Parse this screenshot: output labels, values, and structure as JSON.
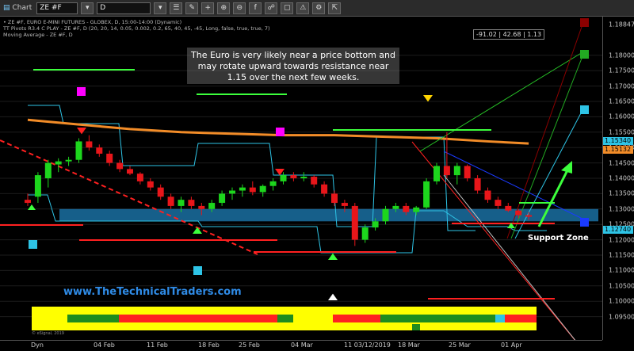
{
  "toolbar": {
    "window_title": "Chart",
    "symbol": "ZE #F",
    "interval": "D"
  },
  "legend": {
    "line1": "• ZE #F, EURO E-MINI FUTURES - GLOBEX, D, 15:00-14:00 (Dynamic)",
    "line2": "TT Pivots R3.4 C PLAY - ZE #F, D (20, 20, 14, 0.05, 0.002, 0.2, 65, 40, 45, -45, Long, false, true, true, 7)",
    "line3": "Moving Average - ZE #F, D"
  },
  "annotation": {
    "note": "The Euro is very likely near a price bottom and may rotate upward towards resistance near 1.15 over the next few weeks.",
    "support_zone": "Support Zone",
    "website": "www.TheTechnicalTraders.com",
    "copyright": "© eSignal, 2019",
    "readout": "-91.02 | 42.68 | 1.13"
  },
  "price_axis": {
    "labels": [
      "1.18847",
      "1.18000",
      "1.17500",
      "1.17000",
      "1.16500",
      "1.16000",
      "1.15500",
      "1.15000",
      "1.14500",
      "1.14000",
      "1.13500",
      "1.13000",
      "1.12500",
      "1.12000",
      "1.11500",
      "1.11000",
      "1.10500",
      "1.10000",
      "1.09500"
    ],
    "tags": [
      {
        "text": "1.15340",
        "color": "#2ec4e6"
      },
      {
        "text": "1.15132",
        "color": "#f28c28"
      },
      {
        "text": "1.12740",
        "color": "#2ec4e6"
      }
    ]
  },
  "date_axis": {
    "labels": [
      "Dyn",
      "04 Feb",
      "11 Feb",
      "18 Feb",
      "25 Feb",
      "04 Mar",
      "11 03/12/2019",
      "18 Mar",
      "25 Mar",
      "01 Apr"
    ]
  },
  "colors": {
    "up_candle": "#1dd61d",
    "down_candle": "#e8161a",
    "moving_average": "#f28c28",
    "pivot_channel": "#2ec4e6",
    "support_zone": "#1e7fb8",
    "website": "#2f8be6"
  },
  "chart_data": {
    "type": "candlestick",
    "candles": [
      {
        "o": 1.133,
        "h": 1.135,
        "l": 1.131,
        "c": 1.132
      },
      {
        "o": 1.134,
        "h": 1.142,
        "l": 1.132,
        "c": 1.141
      },
      {
        "o": 1.14,
        "h": 1.146,
        "l": 1.137,
        "c": 1.145
      },
      {
        "o": 1.1445,
        "h": 1.1465,
        "l": 1.142,
        "c": 1.1455
      },
      {
        "o": 1.1455,
        "h": 1.147,
        "l": 1.144,
        "c": 1.146
      },
      {
        "o": 1.146,
        "h": 1.153,
        "l": 1.145,
        "c": 1.152
      },
      {
        "o": 1.152,
        "h": 1.154,
        "l": 1.149,
        "c": 1.15
      },
      {
        "o": 1.15,
        "h": 1.151,
        "l": 1.147,
        "c": 1.148
      },
      {
        "o": 1.148,
        "h": 1.149,
        "l": 1.144,
        "c": 1.145
      },
      {
        "o": 1.145,
        "h": 1.146,
        "l": 1.142,
        "c": 1.143
      },
      {
        "o": 1.143,
        "h": 1.144,
        "l": 1.141,
        "c": 1.1415
      },
      {
        "o": 1.1415,
        "h": 1.142,
        "l": 1.138,
        "c": 1.139
      },
      {
        "o": 1.139,
        "h": 1.14,
        "l": 1.136,
        "c": 1.137
      },
      {
        "o": 1.137,
        "h": 1.138,
        "l": 1.133,
        "c": 1.134
      },
      {
        "o": 1.134,
        "h": 1.135,
        "l": 1.13,
        "c": 1.131
      },
      {
        "o": 1.131,
        "h": 1.134,
        "l": 1.129,
        "c": 1.133
      },
      {
        "o": 1.133,
        "h": 1.134,
        "l": 1.13,
        "c": 1.131
      },
      {
        "o": 1.131,
        "h": 1.132,
        "l": 1.128,
        "c": 1.13
      },
      {
        "o": 1.13,
        "h": 1.133,
        "l": 1.129,
        "c": 1.132
      },
      {
        "o": 1.132,
        "h": 1.136,
        "l": 1.131,
        "c": 1.135
      },
      {
        "o": 1.135,
        "h": 1.137,
        "l": 1.133,
        "c": 1.136
      },
      {
        "o": 1.136,
        "h": 1.138,
        "l": 1.134,
        "c": 1.137
      },
      {
        "o": 1.137,
        "h": 1.139,
        "l": 1.1345,
        "c": 1.1355
      },
      {
        "o": 1.1355,
        "h": 1.138,
        "l": 1.134,
        "c": 1.1375
      },
      {
        "o": 1.1375,
        "h": 1.14,
        "l": 1.136,
        "c": 1.139
      },
      {
        "o": 1.139,
        "h": 1.142,
        "l": 1.138,
        "c": 1.141
      },
      {
        "o": 1.141,
        "h": 1.142,
        "l": 1.139,
        "c": 1.14
      },
      {
        "o": 1.14,
        "h": 1.142,
        "l": 1.139,
        "c": 1.1405
      },
      {
        "o": 1.1405,
        "h": 1.141,
        "l": 1.137,
        "c": 1.138
      },
      {
        "o": 1.138,
        "h": 1.139,
        "l": 1.134,
        "c": 1.135
      },
      {
        "o": 1.135,
        "h": 1.136,
        "l": 1.131,
        "c": 1.132
      },
      {
        "o": 1.132,
        "h": 1.133,
        "l": 1.129,
        "c": 1.131
      },
      {
        "o": 1.131,
        "h": 1.132,
        "l": 1.118,
        "c": 1.12
      },
      {
        "o": 1.12,
        "h": 1.125,
        "l": 1.119,
        "c": 1.124
      },
      {
        "o": 1.124,
        "h": 1.127,
        "l": 1.123,
        "c": 1.126
      },
      {
        "o": 1.126,
        "h": 1.131,
        "l": 1.125,
        "c": 1.13
      },
      {
        "o": 1.13,
        "h": 1.132,
        "l": 1.129,
        "c": 1.131
      },
      {
        "o": 1.131,
        "h": 1.132,
        "l": 1.128,
        "c": 1.129
      },
      {
        "o": 1.129,
        "h": 1.131,
        "l": 1.128,
        "c": 1.1305
      },
      {
        "o": 1.1305,
        "h": 1.14,
        "l": 1.13,
        "c": 1.139
      },
      {
        "o": 1.139,
        "h": 1.145,
        "l": 1.138,
        "c": 1.144
      },
      {
        "o": 1.144,
        "h": 1.155,
        "l": 1.14,
        "c": 1.141
      },
      {
        "o": 1.141,
        "h": 1.145,
        "l": 1.138,
        "c": 1.144
      },
      {
        "o": 1.144,
        "h": 1.1445,
        "l": 1.139,
        "c": 1.14
      },
      {
        "o": 1.14,
        "h": 1.141,
        "l": 1.135,
        "c": 1.136
      },
      {
        "o": 1.136,
        "h": 1.137,
        "l": 1.132,
        "c": 1.133
      },
      {
        "o": 1.133,
        "h": 1.134,
        "l": 1.13,
        "c": 1.131
      },
      {
        "o": 1.131,
        "h": 1.132,
        "l": 1.129,
        "c": 1.1295
      },
      {
        "o": 1.1295,
        "h": 1.13,
        "l": 1.127,
        "c": 1.128
      },
      {
        "o": 1.128,
        "h": 1.129,
        "l": 1.1265,
        "c": 1.1275
      }
    ],
    "moving_average": [
      [
        0,
        1.159
      ],
      [
        5,
        1.1575
      ],
      [
        10,
        1.156
      ],
      [
        15,
        1.155
      ],
      [
        20,
        1.1545
      ],
      [
        25,
        1.154
      ],
      [
        30,
        1.154
      ],
      [
        35,
        1.1535
      ],
      [
        40,
        1.153
      ],
      [
        45,
        1.152
      ],
      [
        49,
        1.1513
      ]
    ],
    "support_zone": [
      1.126,
      1.13
    ],
    "ylim": [
      1.09,
      1.19
    ]
  }
}
